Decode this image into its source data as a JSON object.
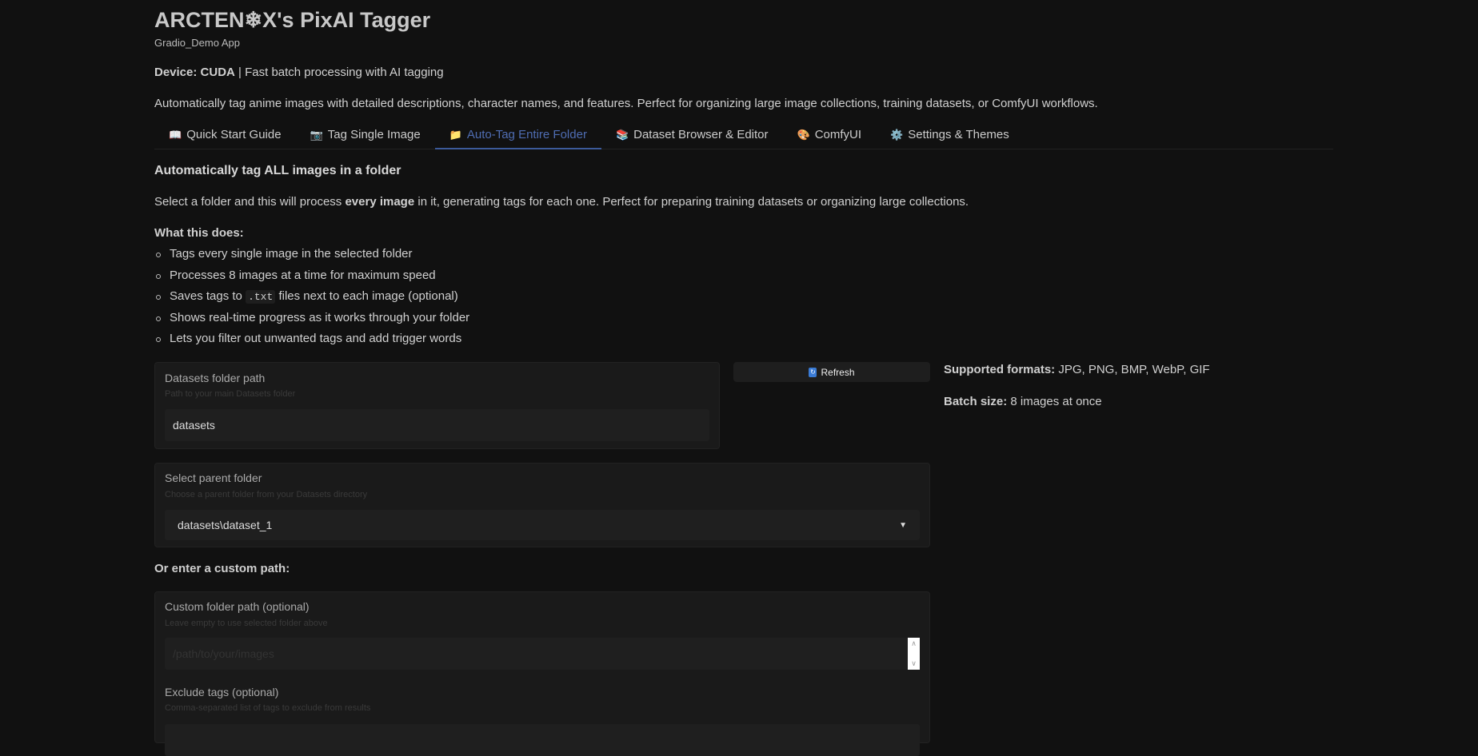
{
  "header": {
    "title": "ARCTEN❄X's PixAI Tagger",
    "subtitle": "Gradio_Demo App",
    "device_label": "Device: CUDA",
    "device_rest": " | Fast batch processing with AI tagging",
    "description": "Automatically tag anime images with detailed descriptions, character names, and features. Perfect for organizing large image collections, training datasets, or ComfyUI workflows."
  },
  "tabs": [
    {
      "icon": "📖",
      "label": "Quick Start Guide"
    },
    {
      "icon": "📷",
      "label": "Tag Single Image"
    },
    {
      "icon": "📁",
      "label": "Auto-Tag Entire Folder"
    },
    {
      "icon": "📚",
      "label": "Dataset Browser & Editor"
    },
    {
      "icon": "🎨",
      "label": "ComfyUI"
    },
    {
      "icon": "⚙️",
      "label": "Settings & Themes"
    }
  ],
  "main": {
    "heading": "Automatically tag ALL images in a folder",
    "para_a": "Select a folder and this will process ",
    "para_b": "every image",
    "para_c": " in it, generating tags for each one. Perfect for preparing training datasets or organizing large collections.",
    "what_title": "What this does:",
    "list": [
      "Tags every single image in the selected folder",
      "Processes 8 images at a time for maximum speed",
      "Saves tags to ",
      ".txt",
      " files next to each image (optional)",
      "Shows real-time progress as it works through your folder",
      "Lets you filter out unwanted tags and add trigger words"
    ],
    "datasets_label": "Datasets folder path",
    "datasets_hint": "Path to your main Datasets folder",
    "datasets_value": "datasets",
    "refresh_label": "Refresh",
    "formats_label": "Supported formats:",
    "formats_value": " JPG, PNG, BMP, WebP, GIF",
    "batch_label": "Batch size:",
    "batch_value": " 8 images at once",
    "parent_label": "Select parent folder",
    "parent_hint": "Choose a parent folder from your Datasets directory",
    "parent_value": "datasets\\dataset_1",
    "custom_heading": "Or enter a custom path:",
    "custom_label": "Custom folder path (optional)",
    "custom_hint": "Leave empty to use selected folder above",
    "custom_placeholder": "/path/to/your/images",
    "exclude_label": "Exclude tags (optional)",
    "exclude_hint": "Comma-separated list of tags to exclude from results"
  }
}
